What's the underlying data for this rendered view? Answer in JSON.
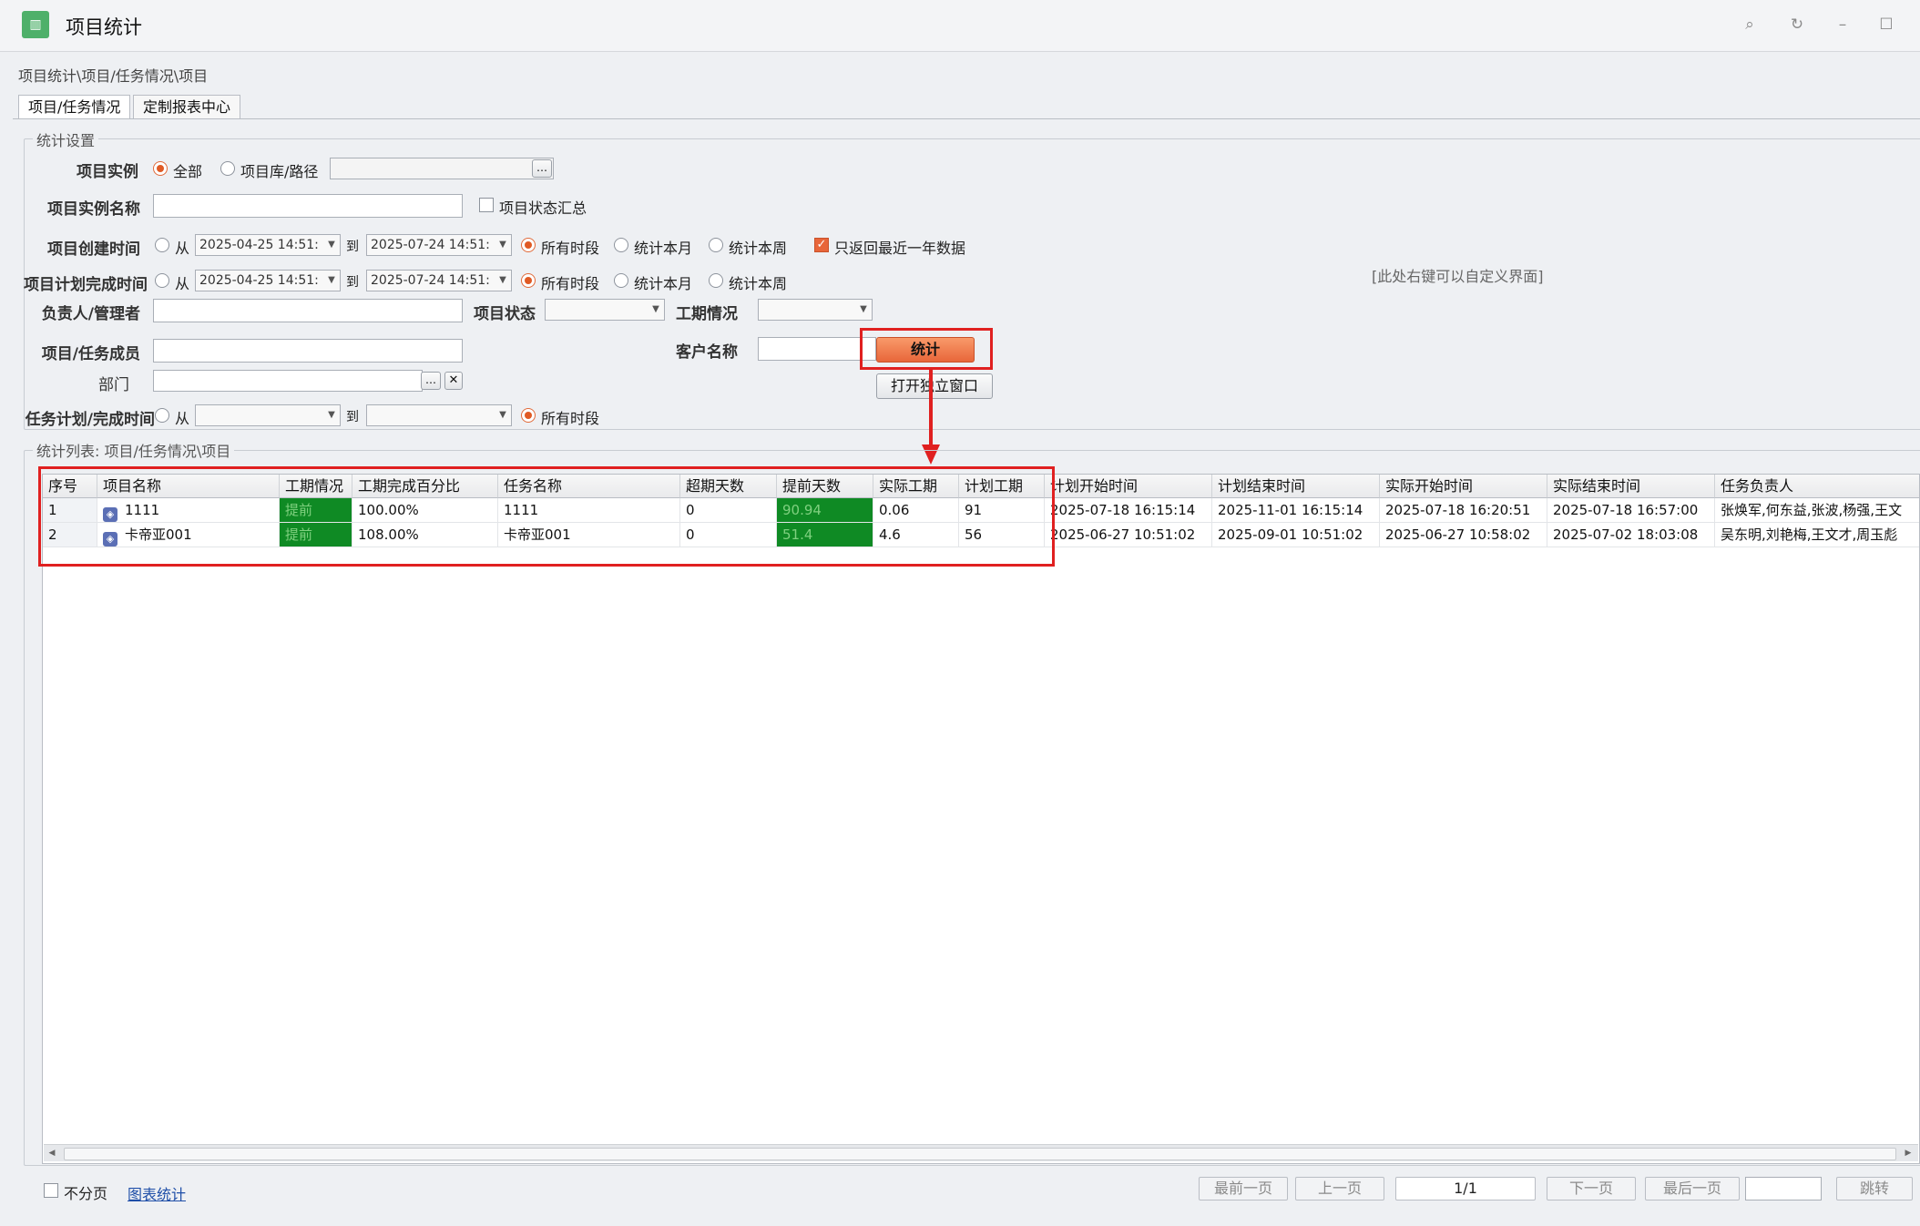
{
  "window": {
    "title": "项目统计",
    "icon": "chart-app-icon"
  },
  "window_controls": [
    "search-icon",
    "refresh-icon",
    "minimize-icon",
    "maximize-icon"
  ],
  "breadcrumb": "项目统计\\项目/任务情况\\项目",
  "tabs": [
    {
      "label": "项目/任务情况",
      "active": true
    },
    {
      "label": "定制报表中心",
      "active": false
    }
  ],
  "settings": {
    "legend": "统计设置",
    "hint": "[此处右键可以自定义界面]",
    "project_instance": {
      "label": "项目实例",
      "opt_all": "全部",
      "opt_path": "项目库/路径",
      "path_value": "",
      "selected": "全部"
    },
    "instance_name": {
      "label": "项目实例名称",
      "value": "",
      "status_summary": "项目状态汇总",
      "status_summary_checked": false
    },
    "create_time": {
      "label": "项目创建时间",
      "from": "从",
      "from_value": "2025-04-25 14:51:",
      "to": "到",
      "to_value": "2025-07-24 14:51:",
      "opt_all": "所有时段",
      "opt_month": "统计本月",
      "opt_week": "统计本周",
      "selected": "所有时段",
      "last_year_label": "只返回最近一年数据",
      "last_year_checked": true
    },
    "plan_finish_time": {
      "label": "项目计划完成时间",
      "from": "从",
      "from_value": "2025-04-25 14:51:",
      "to": "到",
      "to_value": "2025-07-24 14:51:",
      "opt_all": "所有时段",
      "opt_month": "统计本月",
      "opt_week": "统计本周",
      "selected": "所有时段"
    },
    "manager": {
      "label": "负责人/管理者",
      "value": ""
    },
    "project_status": {
      "label": "项目状态",
      "value": ""
    },
    "schedule_status": {
      "label": "工期情况",
      "value": ""
    },
    "member": {
      "label": "项目/任务成员",
      "value": ""
    },
    "customer": {
      "label": "客户名称",
      "value": ""
    },
    "department": {
      "label": "部门",
      "value": ""
    },
    "task_time": {
      "label": "任务计划/完成时间",
      "from": "从",
      "from_value": "",
      "to": "到",
      "to_value": "",
      "opt_all": "所有时段",
      "selected": "所有时段"
    },
    "stat_button": "统计",
    "open_window_button": "打开独立窗口"
  },
  "list": {
    "legend": "统计列表: 项目/任务情况\\项目",
    "columns": [
      "序号",
      "项目名称",
      "工期情况",
      "工期完成百分比",
      "任务名称",
      "超期天数",
      "提前天数",
      "实际工期",
      "计划工期",
      "计划开始时间",
      "计划结束时间",
      "实际开始时间",
      "实际结束时间",
      "任务负责人"
    ],
    "rows": [
      {
        "no": "1",
        "name": "1111",
        "icon": "project-icon",
        "status": "提前",
        "percent": "100.00%",
        "task": "1111",
        "overdue": "0",
        "ahead": "90.94",
        "actual": "0.06",
        "planned": "91",
        "plan_start": "2025-07-18 16:15:14",
        "plan_end": "2025-11-01 16:15:14",
        "real_start": "2025-07-18 16:20:51",
        "real_end": "2025-07-18 16:57:00",
        "owner": "张焕军,何东益,张波,杨强,王文"
      },
      {
        "no": "2",
        "name": "卡帝亚001",
        "icon": "project-icon",
        "status": "提前",
        "percent": "108.00%",
        "task": "卡帝亚001",
        "overdue": "0",
        "ahead": "51.4",
        "actual": "4.6",
        "planned": "56",
        "plan_start": "2025-06-27 10:51:02",
        "plan_end": "2025-09-01 10:51:02",
        "real_start": "2025-06-27 10:58:02",
        "real_end": "2025-07-02 18:03:08",
        "owner": "吴东明,刘艳梅,王文才,周玉彪"
      }
    ]
  },
  "footer": {
    "no_paging": "不分页",
    "no_paging_checked": false,
    "chart_link": "图表统计",
    "first": "最前一页",
    "prev": "上一页",
    "page": "1/1",
    "next": "下一页",
    "last": "最后一页",
    "jump": "跳转"
  },
  "colors": {
    "accent": "#e8663a",
    "green_cell": "#0f8a24",
    "highlight_red": "#e02020"
  }
}
